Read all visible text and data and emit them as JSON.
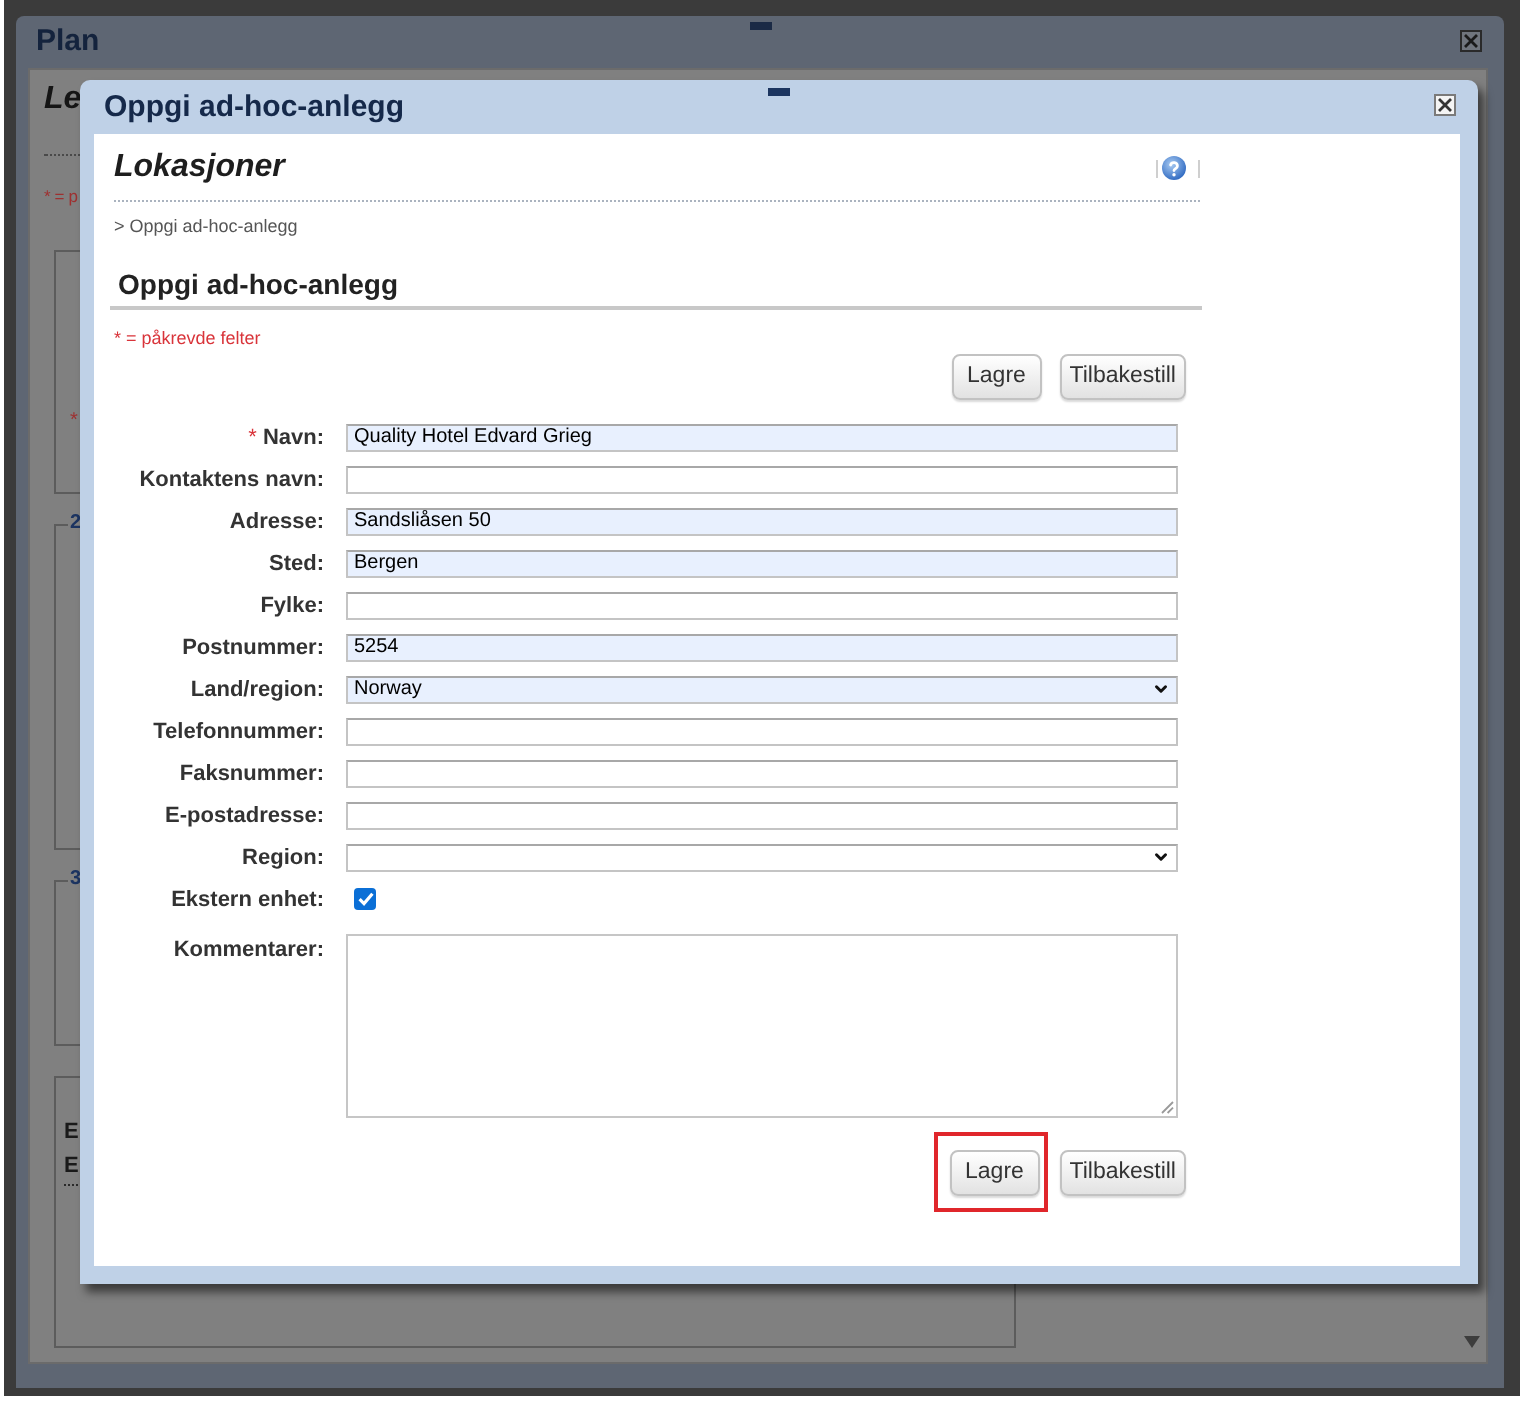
{
  "background_window": {
    "title": "Plan",
    "heading": "Le",
    "required_note": "* = p",
    "fieldsets": [
      {
        "mark": "*"
      },
      {
        "legend": "2"
      },
      {
        "legend": "3"
      },
      {
        "lines": [
          "E",
          "E"
        ]
      }
    ]
  },
  "dialog": {
    "title": "Oppgi ad-hoc-anlegg",
    "page_title": "Lokasjoner",
    "breadcrumb": "> Oppgi ad-hoc-anlegg",
    "section_title": "Oppgi ad-hoc-anlegg",
    "required_note": "* = påkrevde felter",
    "top_buttons": [
      {
        "label": "Lagre",
        "highlighted": false
      },
      {
        "label": "Tilbakestill",
        "highlighted": false
      }
    ],
    "fields": [
      {
        "kind": "text",
        "required_mark": "*",
        "label": "Navn:",
        "value": "Quality Hotel Edvard Grieg",
        "autofilled": true
      },
      {
        "kind": "text",
        "label": "Kontaktens navn:",
        "autofilled": false
      },
      {
        "kind": "text",
        "label": "Adresse:",
        "value": "Sandsliåsen 50",
        "autofilled": true
      },
      {
        "kind": "text",
        "label": "Sted:",
        "value": "Bergen",
        "autofilled": true
      },
      {
        "kind": "text",
        "label": "Fylke:",
        "autofilled": false
      },
      {
        "kind": "text",
        "label": "Postnummer:",
        "value": "5254",
        "autofilled": true
      },
      {
        "kind": "select",
        "label": "Land/region:",
        "value": "Norway",
        "autofilled": true
      },
      {
        "kind": "text",
        "label": "Telefonnummer:",
        "autofilled": false
      },
      {
        "kind": "text",
        "label": "Faksnummer:",
        "autofilled": false
      },
      {
        "kind": "text",
        "label": "E-postadresse:",
        "autofilled": false
      },
      {
        "kind": "select",
        "label": "Region:",
        "autofilled": false
      },
      {
        "kind": "checkbox",
        "label": "Ekstern enhet:",
        "checked": true
      },
      {
        "kind": "textarea",
        "label": "Kommentarer:"
      }
    ],
    "bottom_buttons": [
      {
        "label": "Lagre",
        "highlighted": true
      },
      {
        "label": "Tilbakestill",
        "highlighted": false
      }
    ]
  }
}
